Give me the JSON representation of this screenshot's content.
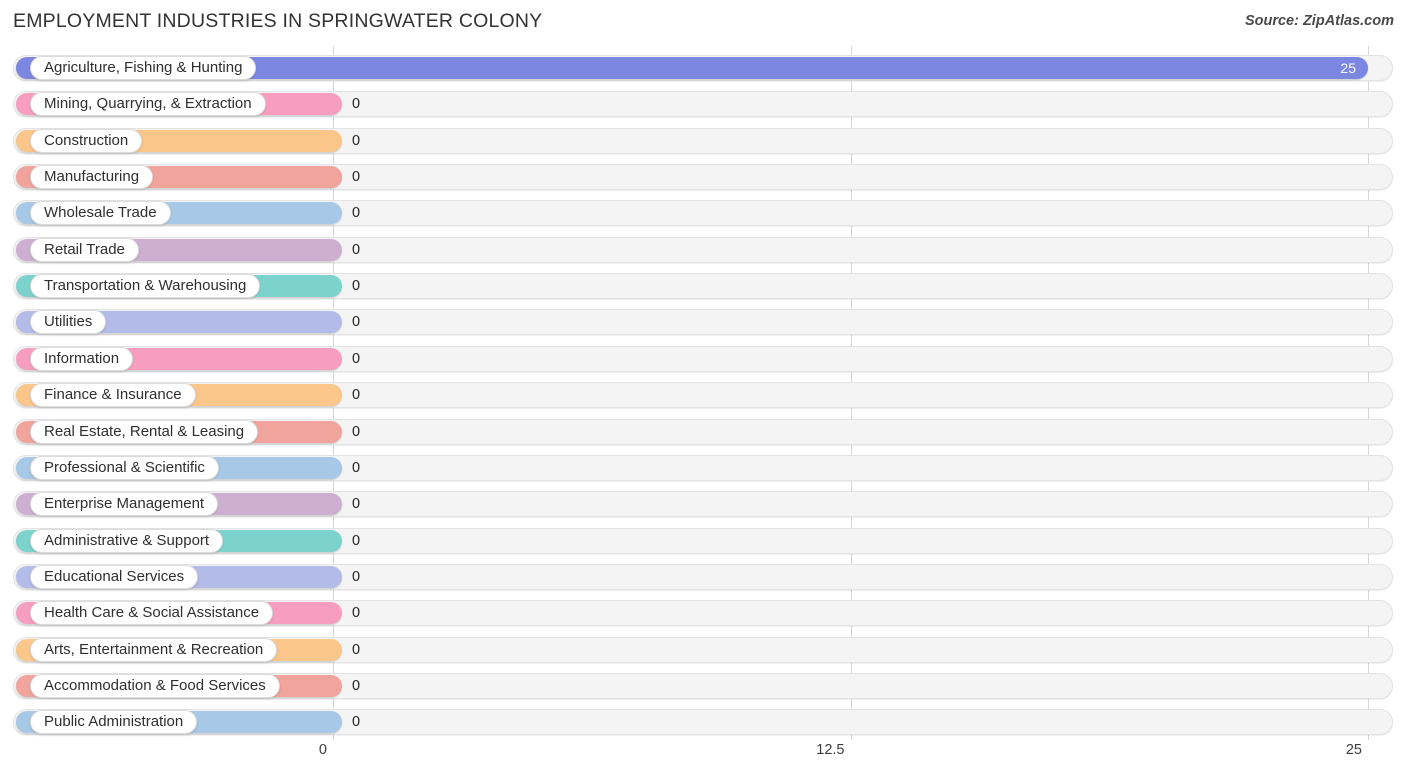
{
  "header": {
    "title": "EMPLOYMENT INDUSTRIES IN SPRINGWATER COLONY",
    "source": "Source: ZipAtlas.com"
  },
  "chart_data": {
    "type": "bar",
    "orientation": "horizontal",
    "title": "EMPLOYMENT INDUSTRIES IN SPRINGWATER COLONY",
    "xlabel": "",
    "ylabel": "",
    "xlim": [
      0,
      25
    ],
    "ticks": [
      "0",
      "12.5",
      "25"
    ],
    "tick_values": [
      0,
      12.5,
      25
    ],
    "grid": true,
    "legend": false,
    "categories": [
      "Agriculture, Fishing & Hunting",
      "Mining, Quarrying, & Extraction",
      "Construction",
      "Manufacturing",
      "Wholesale Trade",
      "Retail Trade",
      "Transportation & Warehousing",
      "Utilities",
      "Information",
      "Finance & Insurance",
      "Real Estate, Rental & Leasing",
      "Professional & Scientific",
      "Enterprise Management",
      "Administrative & Support",
      "Educational Services",
      "Health Care & Social Assistance",
      "Arts, Entertainment & Recreation",
      "Accommodation & Food Services",
      "Public Administration"
    ],
    "values": [
      25,
      0,
      0,
      0,
      0,
      0,
      0,
      0,
      0,
      0,
      0,
      0,
      0,
      0,
      0,
      0,
      0,
      0,
      0
    ],
    "value_labels": [
      "25",
      "0",
      "0",
      "0",
      "0",
      "0",
      "0",
      "0",
      "0",
      "0",
      "0",
      "0",
      "0",
      "0",
      "0",
      "0",
      "0",
      "0",
      "0"
    ],
    "colors": [
      "#7b87e0",
      "#f79ec0",
      "#fbc68a",
      "#f0a49c",
      "#a8c8e8",
      "#ceafd1",
      "#7cd3ce",
      "#b3bbe8",
      "#f79ec0",
      "#fbc68a",
      "#f0a49c",
      "#a8c8e8",
      "#ceafd1",
      "#7cd3ce",
      "#b3bbe8",
      "#f79ec0",
      "#fbc68a",
      "#f0a49c",
      "#a8c8e8"
    ],
    "colors_note": "8-color repeating palette"
  }
}
